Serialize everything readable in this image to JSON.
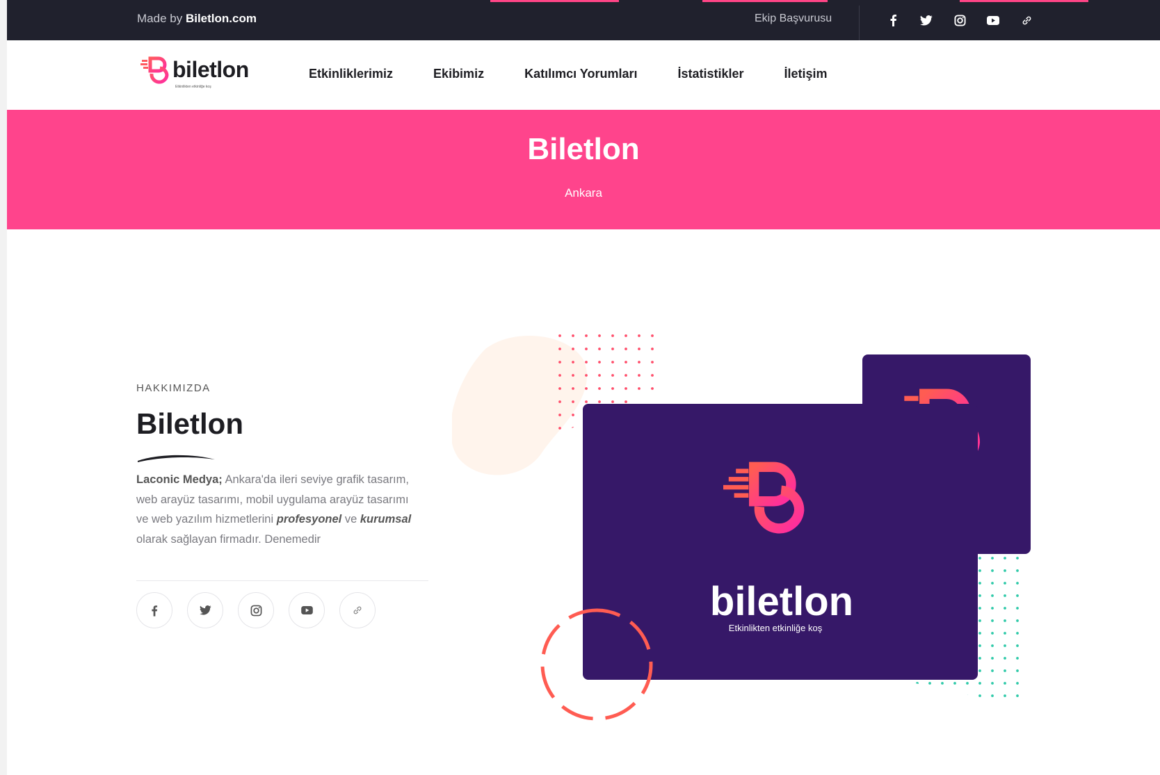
{
  "topbar": {
    "made_by_prefix": "Made by ",
    "made_by_brand": "Biletlon.com",
    "apply_link": "Ekip Başvurusu",
    "social_icons": [
      "facebook-icon",
      "twitter-icon",
      "instagram-icon",
      "youtube-icon",
      "link-icon"
    ]
  },
  "logo": {
    "text": "biletlon",
    "tagline": "Etkinlikten etkinliğe koş"
  },
  "nav": {
    "items": [
      "Etkinliklerimiz",
      "Ekibimiz",
      "Katılımcı Yorumları",
      "İstatistikler",
      "İletişim"
    ]
  },
  "hero": {
    "title": "Biletlon",
    "subtitle": "Ankara"
  },
  "about": {
    "eyebrow": "HAKKIMIZDA",
    "title": "Biletlon",
    "company": "Laconic Medya;",
    "text1": " Ankara'da ileri seviye grafik tasarım, web arayüz tasarımı, mobil uygulama arayüz tasarımı ve web yazılım hizmetlerini ",
    "em1": "profesyonel",
    "text2": " ve ",
    "em2": "kurumsal",
    "text3": " olarak sağlayan firmadır. Denemedir",
    "social_icons": [
      "facebook-icon",
      "twitter-icon",
      "instagram-icon",
      "youtube-icon",
      "link-icon"
    ]
  },
  "artwork": {
    "card_text": "biletlon",
    "card_tagline": "Etkinlikten etkinliğe koş"
  },
  "colors": {
    "accent": "#ff448c",
    "dark": "#20212d",
    "purple": "#361868"
  }
}
